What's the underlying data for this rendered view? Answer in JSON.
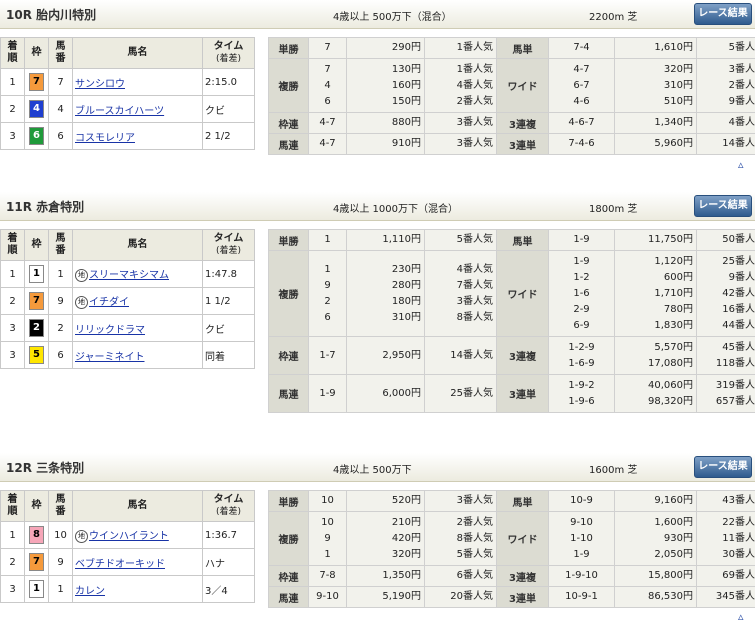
{
  "button_label": "レース結果",
  "up_icon": "▵",
  "headers": {
    "rank": [
      "着",
      "順"
    ],
    "frame": "枠",
    "num": [
      "馬",
      "番"
    ],
    "name": "馬名",
    "time": [
      "タイム",
      "(着差)"
    ]
  },
  "races": [
    {
      "title": "10R 胎内川特別",
      "condition": "4歳以上 500万下（混合）",
      "distance": "2200m 芝",
      "finishers": [
        {
          "rank": "1",
          "frame": "7",
          "num": "7",
          "name": "サンシロウ",
          "time": "2:15.0",
          "chi": ""
        },
        {
          "rank": "2",
          "frame": "4",
          "num": "4",
          "name": "ブルースカイハーツ",
          "time": "クビ",
          "chi": ""
        },
        {
          "rank": "3",
          "frame": "6",
          "num": "6",
          "name": "コスモレリア",
          "time": "2 1/2",
          "chi": ""
        }
      ],
      "payouts": [
        {
          "type": "単勝",
          "nums": [
            "7"
          ],
          "pay": [
            "290円"
          ],
          "pop": [
            "1番人気"
          ],
          "type2": "馬単",
          "nums2": [
            "7-4"
          ],
          "pay2": [
            "1,610円"
          ],
          "pop2": [
            "5番人気"
          ]
        },
        {
          "type": "複勝",
          "nums": [
            "7",
            "4",
            "6"
          ],
          "pay": [
            "130円",
            "160円",
            "150円"
          ],
          "pop": [
            "1番人気",
            "4番人気",
            "2番人気"
          ],
          "type2": "ワイド",
          "nums2": [
            "4-7",
            "6-7",
            "4-6"
          ],
          "pay2": [
            "320円",
            "310円",
            "510円"
          ],
          "pop2": [
            "3番人気",
            "2番人気",
            "9番人気"
          ]
        },
        {
          "type": "枠連",
          "nums": [
            "4-7"
          ],
          "pay": [
            "880円"
          ],
          "pop": [
            "3番人気"
          ],
          "type2": "3連複",
          "nums2": [
            "4-6-7"
          ],
          "pay2": [
            "1,340円"
          ],
          "pop2": [
            "4番人気"
          ]
        },
        {
          "type": "馬連",
          "nums": [
            "4-7"
          ],
          "pay": [
            "910円"
          ],
          "pop": [
            "3番人気"
          ],
          "type2": "3連単",
          "nums2": [
            "7-4-6"
          ],
          "pay2": [
            "5,960円"
          ],
          "pop2": [
            "14番人気"
          ]
        }
      ]
    },
    {
      "title": "11R 赤倉特別",
      "condition": "4歳以上 1000万下（混合）",
      "distance": "1800m 芝",
      "finishers": [
        {
          "rank": "1",
          "frame": "1",
          "num": "1",
          "name": "スリーマキシマム",
          "time": "1:47.8",
          "chi": "地"
        },
        {
          "rank": "2",
          "frame": "7",
          "num": "9",
          "name": "イチダイ",
          "time": "1 1/2",
          "chi": "地"
        },
        {
          "rank": "3",
          "frame": "2",
          "num": "2",
          "name": "リリックドラマ",
          "time": "クビ",
          "chi": ""
        },
        {
          "rank": "3",
          "frame": "5",
          "num": "6",
          "name": "ジャーミネイト",
          "time": "同着",
          "chi": ""
        }
      ],
      "payouts": [
        {
          "type": "単勝",
          "nums": [
            "1"
          ],
          "pay": [
            "1,110円"
          ],
          "pop": [
            "5番人気"
          ],
          "type2": "馬単",
          "nums2": [
            "1-9"
          ],
          "pay2": [
            "11,750円"
          ],
          "pop2": [
            "50番人気"
          ]
        },
        {
          "type": "複勝",
          "nums": [
            "1",
            "9",
            "2",
            "6"
          ],
          "pay": [
            "230円",
            "280円",
            "180円",
            "310円"
          ],
          "pop": [
            "4番人気",
            "7番人気",
            "3番人気",
            "8番人気"
          ],
          "type2": "ワイド",
          "nums2": [
            "1-9",
            "1-2",
            "1-6",
            "2-9",
            "6-9"
          ],
          "pay2": [
            "1,120円",
            "600円",
            "1,710円",
            "780円",
            "1,830円"
          ],
          "pop2": [
            "25番人気",
            "9番人気",
            "42番人気",
            "16番人気",
            "44番人気"
          ]
        },
        {
          "type": "枠連",
          "nums": [
            "1-7"
          ],
          "pay": [
            "2,950円"
          ],
          "pop": [
            "14番人気"
          ],
          "type2": "3連複",
          "nums2": [
            "1-2-9",
            "1-6-9"
          ],
          "pay2": [
            "5,570円",
            "17,080円"
          ],
          "pop2": [
            "45番人気",
            "118番人気"
          ]
        },
        {
          "type": "馬連",
          "nums": [
            "1-9"
          ],
          "pay": [
            "6,000円"
          ],
          "pop": [
            "25番人気"
          ],
          "type2": "3連単",
          "nums2": [
            "1-9-2",
            "1-9-6"
          ],
          "pay2": [
            "40,060円",
            "98,320円"
          ],
          "pop2": [
            "319番人気",
            "657番人気"
          ]
        }
      ]
    },
    {
      "title": "12R 三条特別",
      "condition": "4歳以上 500万下",
      "distance": "1600m 芝",
      "finishers": [
        {
          "rank": "1",
          "frame": "8",
          "num": "10",
          "name": "ウインハイラント",
          "time": "1:36.7",
          "chi": "地"
        },
        {
          "rank": "2",
          "frame": "7",
          "num": "9",
          "name": "ベブチドオーキッド",
          "time": "ハナ",
          "chi": ""
        },
        {
          "rank": "3",
          "frame": "1",
          "num": "1",
          "name": "カレン",
          "time": "3／4",
          "chi": ""
        }
      ],
      "payouts": [
        {
          "type": "単勝",
          "nums": [
            "10"
          ],
          "pay": [
            "520円"
          ],
          "pop": [
            "3番人気"
          ],
          "type2": "馬単",
          "nums2": [
            "10-9"
          ],
          "pay2": [
            "9,160円"
          ],
          "pop2": [
            "43番人気"
          ]
        },
        {
          "type": "複勝",
          "nums": [
            "10",
            "9",
            "1"
          ],
          "pay": [
            "210円",
            "420円",
            "320円"
          ],
          "pop": [
            "2番人気",
            "8番人気",
            "5番人気"
          ],
          "type2": "ワイド",
          "nums2": [
            "9-10",
            "1-10",
            "1-9"
          ],
          "pay2": [
            "1,600円",
            "930円",
            "2,050円"
          ],
          "pop2": [
            "22番人気",
            "11番人気",
            "30番人気"
          ]
        },
        {
          "type": "枠連",
          "nums": [
            "7-8"
          ],
          "pay": [
            "1,350円"
          ],
          "pop": [
            "6番人気"
          ],
          "type2": "3連複",
          "nums2": [
            "1-9-10"
          ],
          "pay2": [
            "15,800円"
          ],
          "pop2": [
            "69番人気"
          ]
        },
        {
          "type": "馬連",
          "nums": [
            "9-10"
          ],
          "pay": [
            "5,190円"
          ],
          "pop": [
            "20番人気"
          ],
          "type2": "3連単",
          "nums2": [
            "10-9-1"
          ],
          "pay2": [
            "86,530円"
          ],
          "pop2": [
            "345番人気"
          ]
        }
      ]
    }
  ],
  "frame_colors": {
    "1": {
      "bg": "#ffffff",
      "fg": "#000000"
    },
    "2": {
      "bg": "#000000",
      "fg": "#ffffff"
    },
    "4": {
      "bg": "#1f3fd0",
      "fg": "#ffffff"
    },
    "5": {
      "bg": "#ffe600",
      "fg": "#000000"
    },
    "6": {
      "bg": "#1f9a3a",
      "fg": "#ffffff"
    },
    "7": {
      "bg": "#f59a3c",
      "fg": "#000000"
    },
    "8": {
      "bg": "#f6a6b8",
      "fg": "#000000"
    }
  }
}
